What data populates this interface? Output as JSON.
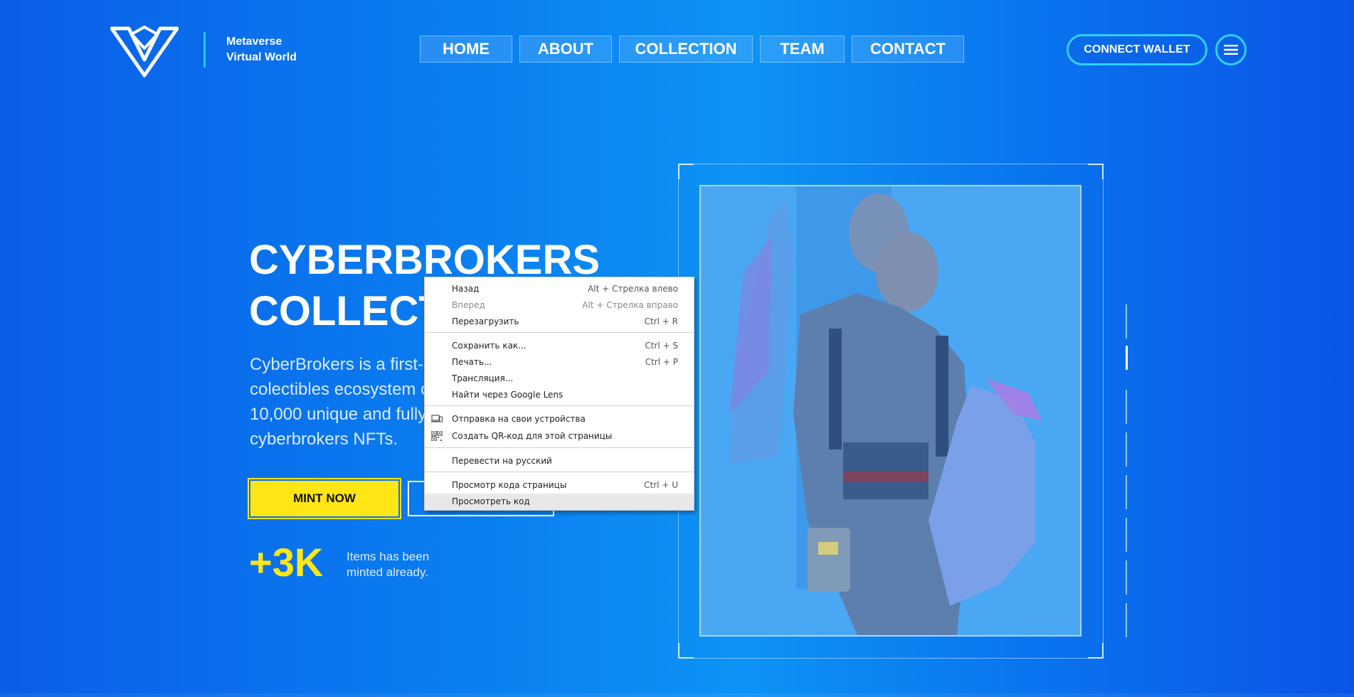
{
  "header": {
    "brand_line1": "Metaverse",
    "brand_line2": "Virtual World",
    "nav": [
      "HOME",
      "ABOUT",
      "COLLECTION",
      "TEAM",
      "CONTACT"
    ],
    "connect_label": "CONNECT WALLET",
    "menu_icon": "hamburger-icon",
    "logo_icon": "brand-logo-icon"
  },
  "hero": {
    "title_line1": "CYBERBROKERS",
    "title_line2": "COLLECTION",
    "desc_lines": [
      "CyberBrokers is a first-",
      "colectibles ecosystem c",
      "10,000 unique and fully",
      "cyberbrokers NFTs."
    ],
    "mint_label": "MINT NOW",
    "second_label": "",
    "stat_value": "+3K",
    "stat_label_line1": "Items has been",
    "stat_label_line2": "minted already."
  },
  "context_menu": {
    "items": [
      {
        "label": "Назад",
        "shortcut": "Alt + Стрелка влево"
      },
      {
        "label": "Вперед",
        "shortcut": "Alt + Стрелка вправо"
      },
      {
        "label": "Перезагрузить",
        "shortcut": "Ctrl + R"
      },
      {
        "label": "Сохранить как...",
        "shortcut": "Ctrl + S"
      },
      {
        "label": "Печать...",
        "shortcut": "Ctrl + P"
      },
      {
        "label": "Трансляция..."
      },
      {
        "label": "Найти через Google Lens"
      },
      {
        "label": "Отправка на свои устройства",
        "icon": "devices-icon"
      },
      {
        "label": "Создать QR-код для этой страницы",
        "icon": "qr-code-icon"
      },
      {
        "label": "Перевести на русский"
      },
      {
        "label": "Просмотр кода страницы",
        "shortcut": "Ctrl + U"
      },
      {
        "label": "Просмотреть код"
      }
    ]
  },
  "colors": {
    "accent_yellow": "#ffe614",
    "accent_cyan": "#2fd0ff",
    "bg_blue": "#0a7ff0"
  }
}
